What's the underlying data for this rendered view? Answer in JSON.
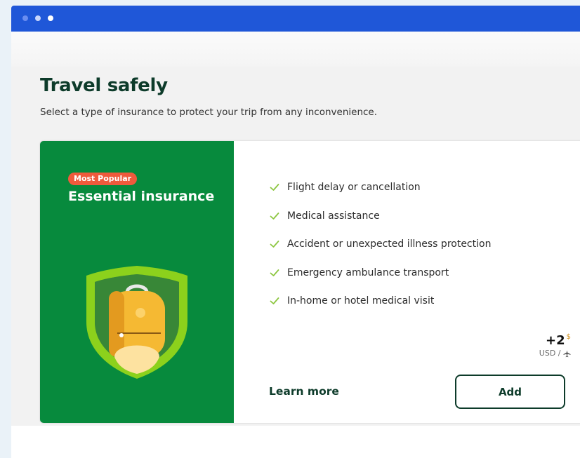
{
  "page": {
    "title": "Travel safely",
    "subtitle": "Select a type of insurance to protect your trip from any inconvenience."
  },
  "plan": {
    "badge": "Most Popular",
    "name": "Essential insurance",
    "features": [
      "Flight delay or cancellation",
      "Medical assistance",
      "Accident or unexpected illness protection",
      "Emergency ambulance transport",
      "In-home or hotel medical visit"
    ],
    "price": {
      "amount": "+2",
      "currency_symbol": "$",
      "unit": "USD /"
    },
    "learn_more_label": "Learn more",
    "add_label": "Add"
  },
  "icons": {
    "feature_check": "check-icon",
    "per_flight": "airplane-icon",
    "illustration": "shield-backpack-icon"
  },
  "colors": {
    "titlebar": "#1f57d8",
    "card_accent": "#078a3d",
    "badge": "#ef5a3c",
    "check": "#8cc63f",
    "heading": "#0d3b2a"
  }
}
